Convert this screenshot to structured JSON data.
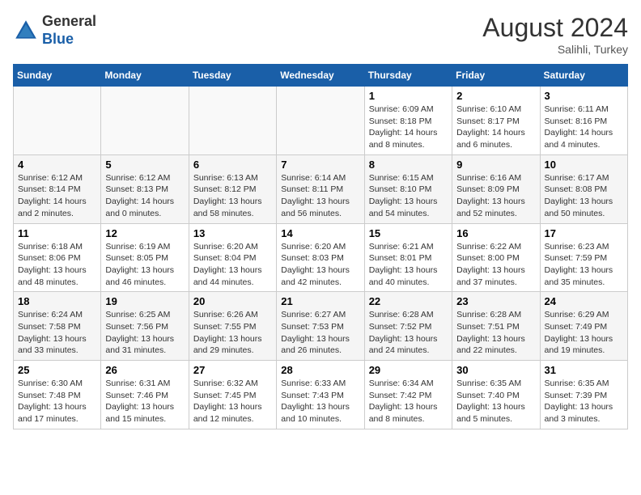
{
  "header": {
    "logo_line1": "General",
    "logo_line2": "Blue",
    "month_year": "August 2024",
    "location": "Salihli, Turkey"
  },
  "weekdays": [
    "Sunday",
    "Monday",
    "Tuesday",
    "Wednesday",
    "Thursday",
    "Friday",
    "Saturday"
  ],
  "weeks": [
    [
      {
        "day": "",
        "info": ""
      },
      {
        "day": "",
        "info": ""
      },
      {
        "day": "",
        "info": ""
      },
      {
        "day": "",
        "info": ""
      },
      {
        "day": "1",
        "info": "Sunrise: 6:09 AM\nSunset: 8:18 PM\nDaylight: 14 hours\nand 8 minutes."
      },
      {
        "day": "2",
        "info": "Sunrise: 6:10 AM\nSunset: 8:17 PM\nDaylight: 14 hours\nand 6 minutes."
      },
      {
        "day": "3",
        "info": "Sunrise: 6:11 AM\nSunset: 8:16 PM\nDaylight: 14 hours\nand 4 minutes."
      }
    ],
    [
      {
        "day": "4",
        "info": "Sunrise: 6:12 AM\nSunset: 8:14 PM\nDaylight: 14 hours\nand 2 minutes."
      },
      {
        "day": "5",
        "info": "Sunrise: 6:12 AM\nSunset: 8:13 PM\nDaylight: 14 hours\nand 0 minutes."
      },
      {
        "day": "6",
        "info": "Sunrise: 6:13 AM\nSunset: 8:12 PM\nDaylight: 13 hours\nand 58 minutes."
      },
      {
        "day": "7",
        "info": "Sunrise: 6:14 AM\nSunset: 8:11 PM\nDaylight: 13 hours\nand 56 minutes."
      },
      {
        "day": "8",
        "info": "Sunrise: 6:15 AM\nSunset: 8:10 PM\nDaylight: 13 hours\nand 54 minutes."
      },
      {
        "day": "9",
        "info": "Sunrise: 6:16 AM\nSunset: 8:09 PM\nDaylight: 13 hours\nand 52 minutes."
      },
      {
        "day": "10",
        "info": "Sunrise: 6:17 AM\nSunset: 8:08 PM\nDaylight: 13 hours\nand 50 minutes."
      }
    ],
    [
      {
        "day": "11",
        "info": "Sunrise: 6:18 AM\nSunset: 8:06 PM\nDaylight: 13 hours\nand 48 minutes."
      },
      {
        "day": "12",
        "info": "Sunrise: 6:19 AM\nSunset: 8:05 PM\nDaylight: 13 hours\nand 46 minutes."
      },
      {
        "day": "13",
        "info": "Sunrise: 6:20 AM\nSunset: 8:04 PM\nDaylight: 13 hours\nand 44 minutes."
      },
      {
        "day": "14",
        "info": "Sunrise: 6:20 AM\nSunset: 8:03 PM\nDaylight: 13 hours\nand 42 minutes."
      },
      {
        "day": "15",
        "info": "Sunrise: 6:21 AM\nSunset: 8:01 PM\nDaylight: 13 hours\nand 40 minutes."
      },
      {
        "day": "16",
        "info": "Sunrise: 6:22 AM\nSunset: 8:00 PM\nDaylight: 13 hours\nand 37 minutes."
      },
      {
        "day": "17",
        "info": "Sunrise: 6:23 AM\nSunset: 7:59 PM\nDaylight: 13 hours\nand 35 minutes."
      }
    ],
    [
      {
        "day": "18",
        "info": "Sunrise: 6:24 AM\nSunset: 7:58 PM\nDaylight: 13 hours\nand 33 minutes."
      },
      {
        "day": "19",
        "info": "Sunrise: 6:25 AM\nSunset: 7:56 PM\nDaylight: 13 hours\nand 31 minutes."
      },
      {
        "day": "20",
        "info": "Sunrise: 6:26 AM\nSunset: 7:55 PM\nDaylight: 13 hours\nand 29 minutes."
      },
      {
        "day": "21",
        "info": "Sunrise: 6:27 AM\nSunset: 7:53 PM\nDaylight: 13 hours\nand 26 minutes."
      },
      {
        "day": "22",
        "info": "Sunrise: 6:28 AM\nSunset: 7:52 PM\nDaylight: 13 hours\nand 24 minutes."
      },
      {
        "day": "23",
        "info": "Sunrise: 6:28 AM\nSunset: 7:51 PM\nDaylight: 13 hours\nand 22 minutes."
      },
      {
        "day": "24",
        "info": "Sunrise: 6:29 AM\nSunset: 7:49 PM\nDaylight: 13 hours\nand 19 minutes."
      }
    ],
    [
      {
        "day": "25",
        "info": "Sunrise: 6:30 AM\nSunset: 7:48 PM\nDaylight: 13 hours\nand 17 minutes."
      },
      {
        "day": "26",
        "info": "Sunrise: 6:31 AM\nSunset: 7:46 PM\nDaylight: 13 hours\nand 15 minutes."
      },
      {
        "day": "27",
        "info": "Sunrise: 6:32 AM\nSunset: 7:45 PM\nDaylight: 13 hours\nand 12 minutes."
      },
      {
        "day": "28",
        "info": "Sunrise: 6:33 AM\nSunset: 7:43 PM\nDaylight: 13 hours\nand 10 minutes."
      },
      {
        "day": "29",
        "info": "Sunrise: 6:34 AM\nSunset: 7:42 PM\nDaylight: 13 hours\nand 8 minutes."
      },
      {
        "day": "30",
        "info": "Sunrise: 6:35 AM\nSunset: 7:40 PM\nDaylight: 13 hours\nand 5 minutes."
      },
      {
        "day": "31",
        "info": "Sunrise: 6:35 AM\nSunset: 7:39 PM\nDaylight: 13 hours\nand 3 minutes."
      }
    ]
  ]
}
